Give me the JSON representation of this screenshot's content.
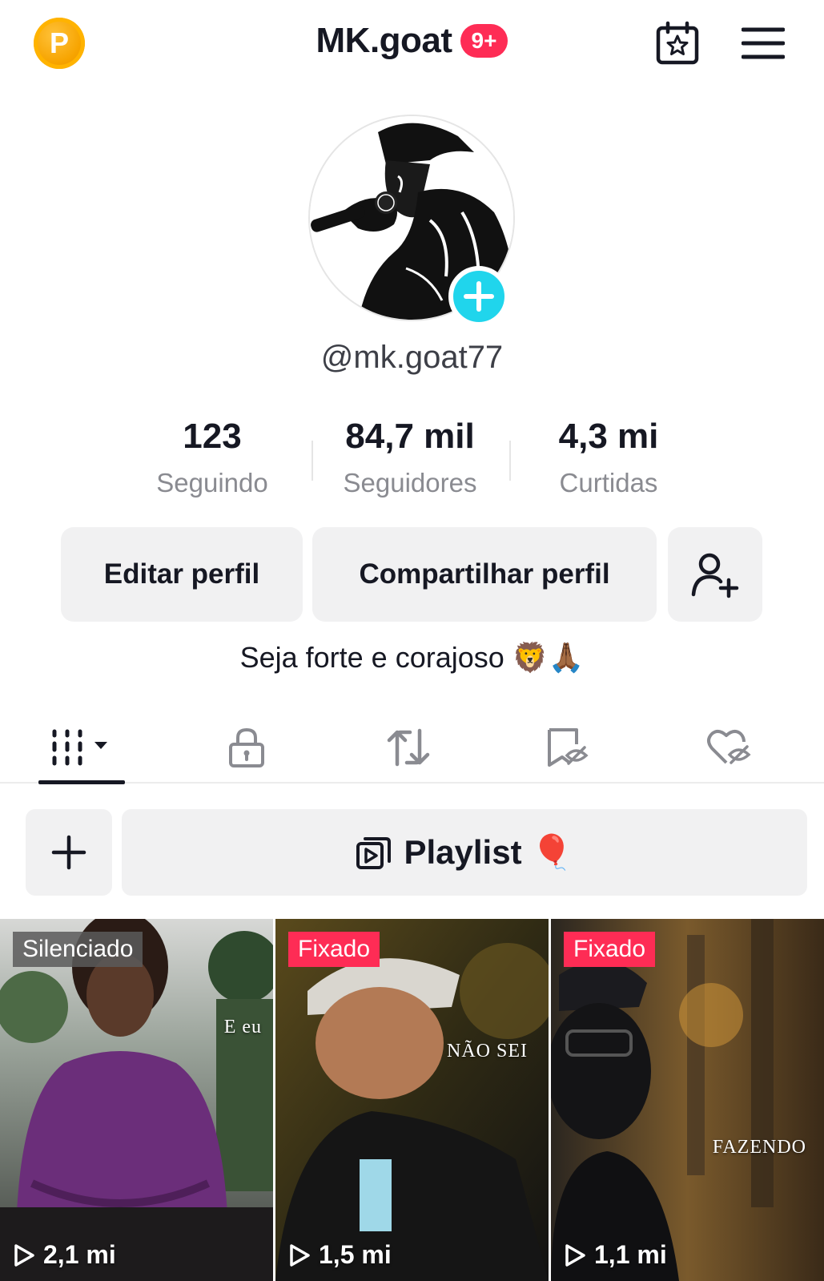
{
  "header": {
    "coin_letter": "P",
    "title": "MK.goat",
    "notifications_badge": "9+"
  },
  "profile": {
    "username": "@mk.goat77",
    "bio": "Seja forte e corajoso 🦁🙏🏾"
  },
  "stats": [
    {
      "value": "123",
      "label": "Seguindo"
    },
    {
      "value": "84,7 mil",
      "label": "Seguidores"
    },
    {
      "value": "4,3 mi",
      "label": "Curtidas"
    }
  ],
  "buttons": {
    "edit_profile": "Editar perfil",
    "share_profile": "Compartilhar perfil"
  },
  "tabs": [
    {
      "icon": "grid-icon",
      "active": true
    },
    {
      "icon": "lock-icon",
      "active": false
    },
    {
      "icon": "repost-icon",
      "active": false
    },
    {
      "icon": "bookmark-hidden-icon",
      "active": false
    },
    {
      "icon": "liked-hidden-icon",
      "active": false
    }
  ],
  "playlist": {
    "label": "Playlist 🎈"
  },
  "videos": [
    {
      "badge": "Silenciado",
      "views": "2,1 mi",
      "caption": "E eu"
    },
    {
      "badge": "Fixado",
      "views": "1,5 mi",
      "caption": "NÃO SEI"
    },
    {
      "badge": "Fixado",
      "views": "1,1 mi",
      "caption": "FAZENDO"
    }
  ],
  "colors": {
    "accent": "#fe2c55",
    "avatar_add": "#20d5ec",
    "coin": "#f7a400",
    "button_bg": "#f1f1f2"
  }
}
